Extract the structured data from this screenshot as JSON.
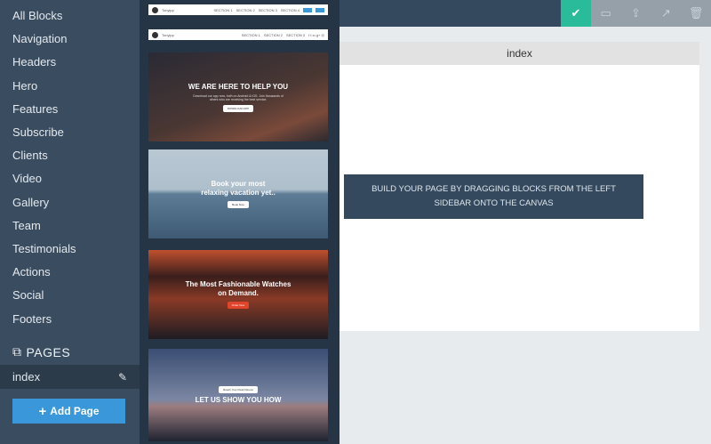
{
  "sidebar": {
    "categories": [
      "All Blocks",
      "Navigation",
      "Headers",
      "Hero",
      "Features",
      "Subscribe",
      "Clients",
      "Video",
      "Gallery",
      "Team",
      "Testimonials",
      "Actions",
      "Social",
      "Footers"
    ],
    "pages_heading": "PAGES",
    "pages": [
      {
        "name": "index"
      }
    ],
    "add_page_label": "Add Page"
  },
  "thumbnails": [
    {
      "type": "nav",
      "brand": "Tonyipp",
      "links": [
        "SECTION 1",
        "SECTION 2",
        "SECTION 3",
        "SECTION 4"
      ]
    },
    {
      "type": "nav",
      "brand": "Tonyipp",
      "links": [
        "SECTION 1",
        "SECTION 2",
        "SECTION 3"
      ]
    },
    {
      "type": "hero",
      "title": "WE ARE HERE TO HELP YOU",
      "subtitle": "Download our app now, both on Android & iOS. Join thousands of others who are receiving the best service.",
      "button": "DOWNLOAD APP",
      "color": "#3d3030"
    },
    {
      "type": "hero",
      "title": "Book your most relaxing vacation yet..",
      "button": "Book Now",
      "color": "#6f8aa0"
    },
    {
      "type": "hero",
      "title": "The Most Fashionable Watches on Demand.",
      "button": "Order Now",
      "color": "#6a2e20"
    },
    {
      "type": "hero",
      "title": "LET US SHOW YOU HOW",
      "button": "Reach Your Peak Fitness",
      "color": "#2c3a55"
    }
  ],
  "canvas": {
    "page_tab": "index",
    "message": "BUILD YOUR PAGE BY DRAGGING BLOCKS FROM THE LEFT SIDEBAR ONTO THE CANVAS"
  },
  "colors": {
    "accent": "#2abb9b",
    "button": "#3a97d9",
    "sidebar": "#3a4c5f"
  }
}
